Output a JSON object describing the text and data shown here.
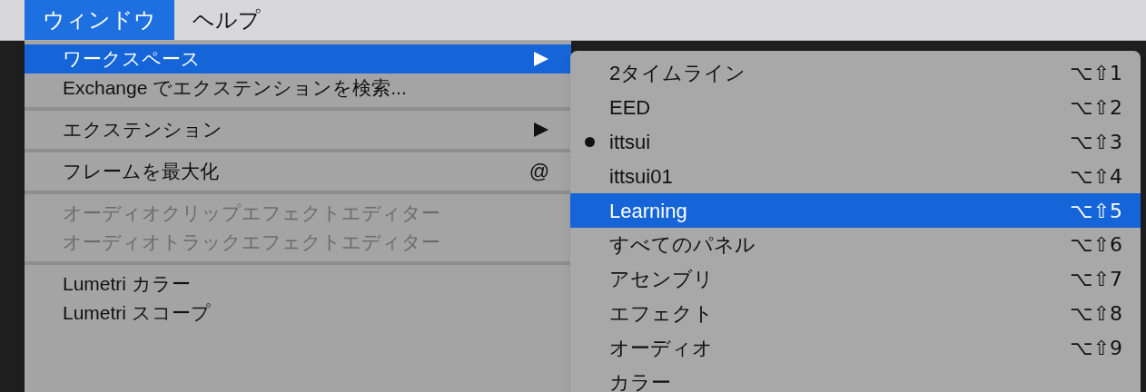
{
  "menu_bar": [
    {
      "label": "ウィンドウ",
      "selected": true
    },
    {
      "label": "ヘルプ",
      "selected": false
    }
  ],
  "menu": [
    {
      "kind": "item",
      "label": "ワークスペース",
      "selected": true,
      "disabled": false,
      "submenu": true
    },
    {
      "kind": "item",
      "label": "Exchange でエクステンションを検索...",
      "selected": false,
      "disabled": false,
      "submenu": false
    },
    {
      "kind": "separator"
    },
    {
      "kind": "item",
      "label": "エクステンション",
      "selected": false,
      "disabled": false,
      "submenu": true
    },
    {
      "kind": "separator"
    },
    {
      "kind": "item",
      "label": "フレームを最大化",
      "shortcut": "@",
      "selected": false,
      "disabled": false,
      "submenu": false
    },
    {
      "kind": "separator"
    },
    {
      "kind": "item",
      "label": "オーディオクリップエフェクトエディター",
      "selected": false,
      "disabled": true,
      "submenu": false
    },
    {
      "kind": "item",
      "label": "オーディオトラックエフェクトエディター",
      "selected": false,
      "disabled": true,
      "submenu": false
    },
    {
      "kind": "separator"
    },
    {
      "kind": "item",
      "label": "Lumetri カラー",
      "selected": false,
      "disabled": false,
      "submenu": false
    },
    {
      "kind": "item",
      "label": "Lumetri スコープ",
      "selected": false,
      "disabled": false,
      "submenu": false
    }
  ],
  "submenu": [
    {
      "label": "2タイムライン",
      "shortcut": "⌥⇧1",
      "checked": false,
      "selected": false
    },
    {
      "label": "EED",
      "shortcut": "⌥⇧2",
      "checked": false,
      "selected": false
    },
    {
      "label": "ittsui",
      "shortcut": "⌥⇧3",
      "checked": true,
      "selected": false
    },
    {
      "label": "ittsui01",
      "shortcut": "⌥⇧4",
      "checked": false,
      "selected": false
    },
    {
      "label": "Learning",
      "shortcut": "⌥⇧5",
      "checked": false,
      "selected": true
    },
    {
      "label": "すべてのパネル",
      "shortcut": "⌥⇧6",
      "checked": false,
      "selected": false
    },
    {
      "label": "アセンブリ",
      "shortcut": "⌥⇧7",
      "checked": false,
      "selected": false
    },
    {
      "label": "エフェクト",
      "shortcut": "⌥⇧8",
      "checked": false,
      "selected": false
    },
    {
      "label": "オーディオ",
      "shortcut": "⌥⇧9",
      "checked": false,
      "selected": false
    },
    {
      "label": "カラー",
      "checked": false,
      "selected": false
    }
  ]
}
